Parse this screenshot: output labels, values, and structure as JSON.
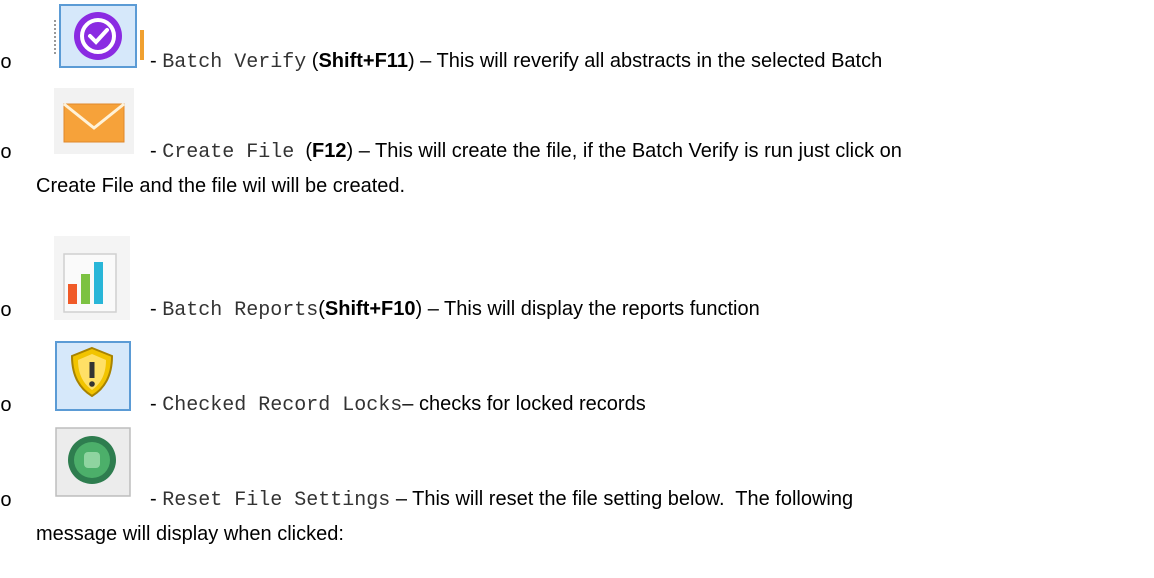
{
  "bullet": "o",
  "items": [
    {
      "dash": "- ",
      "command": "Batch Verify",
      "open_paren": " (",
      "shortcut": "Shift+F11",
      "close_paren": ")",
      "description": " – This will reverify all abstracts in the selected Batch",
      "icon": "verify-check-icon"
    },
    {
      "dash": "- ",
      "command": "Create File",
      "open_paren": "  (",
      "shortcut": "F12",
      "close_paren": ")",
      "description": " – This will create the file, if the Batch Verify is run just click on",
      "continuation": "Create File and the file wil will be created.",
      "icon": "envelope-icon"
    },
    {
      "dash": "- ",
      "command": "Batch Reports",
      "open_paren": "(",
      "shortcut": "Shift+F10",
      "close_paren": ")",
      "description": " – This will display the reports function",
      "icon": "bar-chart-icon"
    },
    {
      "dash": "- ",
      "command": "Checked Record Locks",
      "description": "– checks for locked records",
      "icon": "shield-warning-icon"
    },
    {
      "dash": "- ",
      "command": "Reset File Settings",
      "description": " – This will reset the file setting below.  The following",
      "continuation": "message will display when clicked:",
      "icon": "reset-circle-icon"
    }
  ]
}
